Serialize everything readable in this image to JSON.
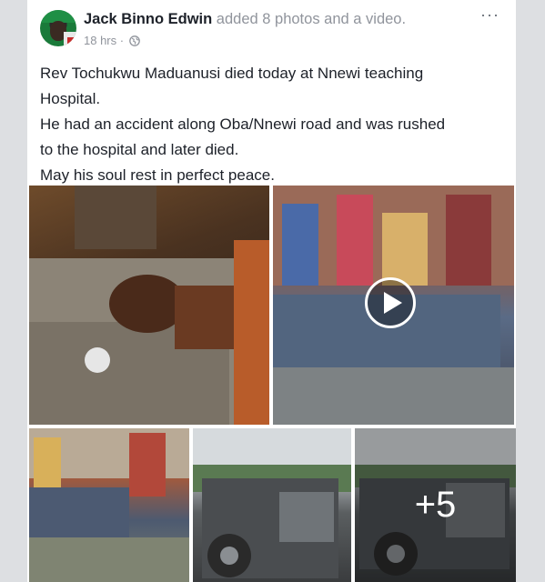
{
  "post": {
    "author": "Jack Binno Edwin",
    "action": "added 8 photos and a video.",
    "timestamp": "18 hrs",
    "separator": " · ",
    "privacy_icon": "globe-icon",
    "more_icon": "more-options-icon",
    "more_label": "···",
    "text_lines": [
      "Rev Tochukwu Maduanusi  died today at Nnewi teaching",
      "Hospital.",
      "He had an accident along Oba/Nnewi road and was rushed",
      "to the hospital and later died.",
      "May his soul rest in perfect peace."
    ],
    "photos": [
      {
        "name": "photo-1",
        "kind": "image"
      },
      {
        "name": "video-1",
        "kind": "video",
        "icon": "play-icon"
      },
      {
        "name": "photo-2",
        "kind": "image"
      },
      {
        "name": "photo-3",
        "kind": "image"
      },
      {
        "name": "photo-4",
        "kind": "image",
        "overlay": "+5"
      }
    ]
  },
  "colors": {
    "background": "#dddfe2",
    "card": "#ffffff",
    "author": "#1d2129",
    "secondary_text": "#90949c"
  }
}
